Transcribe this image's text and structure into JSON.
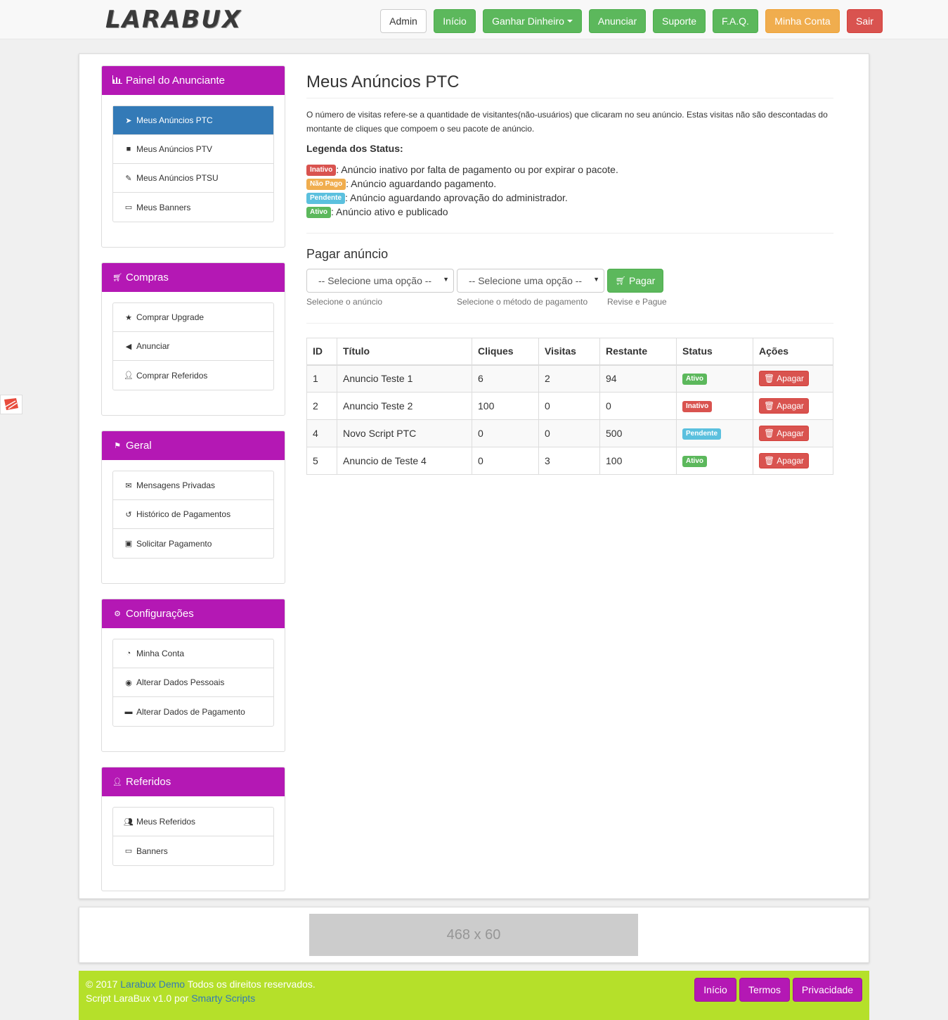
{
  "brand": {
    "logo_text": "LARABUX"
  },
  "nav": {
    "admin": "Admin",
    "inicio": "Início",
    "ganhar": "Ganhar Dinheiro",
    "anunciar": "Anunciar",
    "suporte": "Suporte",
    "faq": "F.A.Q.",
    "conta": "Minha Conta",
    "sair": "Sair"
  },
  "sidebar": {
    "painel": {
      "title": "Painel do Anunciante",
      "items": [
        {
          "label": "Meus Anúncios PTC",
          "icon": "pointer-icon"
        },
        {
          "label": "Meus Anúncios PTV",
          "icon": "video-camera-icon"
        },
        {
          "label": "Meus Anúncios PTSU",
          "icon": "edit-icon"
        },
        {
          "label": "Meus Banners",
          "icon": "monitor-icon"
        }
      ]
    },
    "compras": {
      "title": "Compras",
      "items": [
        {
          "label": "Comprar Upgrade",
          "icon": "star-icon"
        },
        {
          "label": "Anunciar",
          "icon": "bullhorn-icon"
        },
        {
          "label": "Comprar Referidos",
          "icon": "user-plus-icon"
        }
      ]
    },
    "geral": {
      "title": "Geral",
      "items": [
        {
          "label": "Mensagens Privadas",
          "icon": "envelope-icon"
        },
        {
          "label": "Histórico de Pagamentos",
          "icon": "history-icon"
        },
        {
          "label": "Solicitar Pagamento",
          "icon": "money-icon"
        }
      ]
    },
    "config": {
      "title": "Configurações",
      "items": [
        {
          "label": "Minha Conta",
          "icon": "pie-chart-icon"
        },
        {
          "label": "Alterar Dados Pessoais",
          "icon": "user-circle-icon"
        },
        {
          "label": "Alterar Dados de Pagamento",
          "icon": "credit-card-icon"
        }
      ]
    },
    "referidos": {
      "title": "Referidos",
      "items": [
        {
          "label": "Meus Referidos",
          "icon": "users-icon"
        },
        {
          "label": "Banners",
          "icon": "monitor-icon"
        }
      ]
    }
  },
  "main": {
    "title": "Meus Anúncios PTC",
    "desc_line1": "O número de visitas refere-se a quantidade de visitantes(não-usuários) que clicaram no seu anúncio. Estas visitas não são descontadas do",
    "desc_line2": "montante de cliques que compoem o seu pacote de anúncio.",
    "legend_title": "Legenda dos Status:",
    "legend": [
      {
        "label": "Inativo",
        "text": ": Anúncio inativo por falta de pagamento ou por expirar o pacote."
      },
      {
        "label": "Não Pago",
        "text": ": Anúncio aguardando pagamento."
      },
      {
        "label": "Pendente",
        "text": ": Anúncio aguardando aprovação do administrador."
      },
      {
        "label": "Ativo",
        "text": ": Anúncio ativo e publicado"
      }
    ],
    "pay": {
      "title": "Pagar anúncio",
      "select1": "-- Selecione uma opção --",
      "select2": "-- Selecione uma opção --",
      "button": "Pagar",
      "help1": "Selecione o anúncio",
      "help2": "Selecione o método de pagamento",
      "help3": "Revise e Pague"
    },
    "table": {
      "headers": [
        "ID",
        "Título",
        "Cliques",
        "Visitas",
        "Restante",
        "Status",
        "Ações"
      ],
      "action_label": "Apagar",
      "rows": [
        {
          "id": "1",
          "titulo": "Anuncio Teste 1",
          "cliques": "6",
          "visitas": "2",
          "restante": "94",
          "status": "Ativo"
        },
        {
          "id": "2",
          "titulo": "Anuncio Teste 2",
          "cliques": "100",
          "visitas": "0",
          "restante": "0",
          "status": "Inativo"
        },
        {
          "id": "4",
          "titulo": "Novo Script PTC",
          "cliques": "0",
          "visitas": "0",
          "restante": "500",
          "status": "Pendente"
        },
        {
          "id": "5",
          "titulo": "Anuncio de Teste 4",
          "cliques": "0",
          "visitas": "3",
          "restante": "100",
          "status": "Ativo"
        }
      ]
    }
  },
  "banner": {
    "text": "468 x 60"
  },
  "footer": {
    "copy_prefix": "© 2017",
    "site_link": "Larabux Demo",
    "rights": "Todos os direitos reservados.",
    "script_text": "Script LaraBux v1.0 por",
    "author_link": "Smarty Scripts",
    "links": {
      "inicio": "Início",
      "termos": "Termos",
      "privacidade": "Privacidade"
    }
  },
  "colors": {
    "panel_head": "#b418b4",
    "footer_bg": "#b5e02a",
    "active_item": "#337ab7"
  }
}
